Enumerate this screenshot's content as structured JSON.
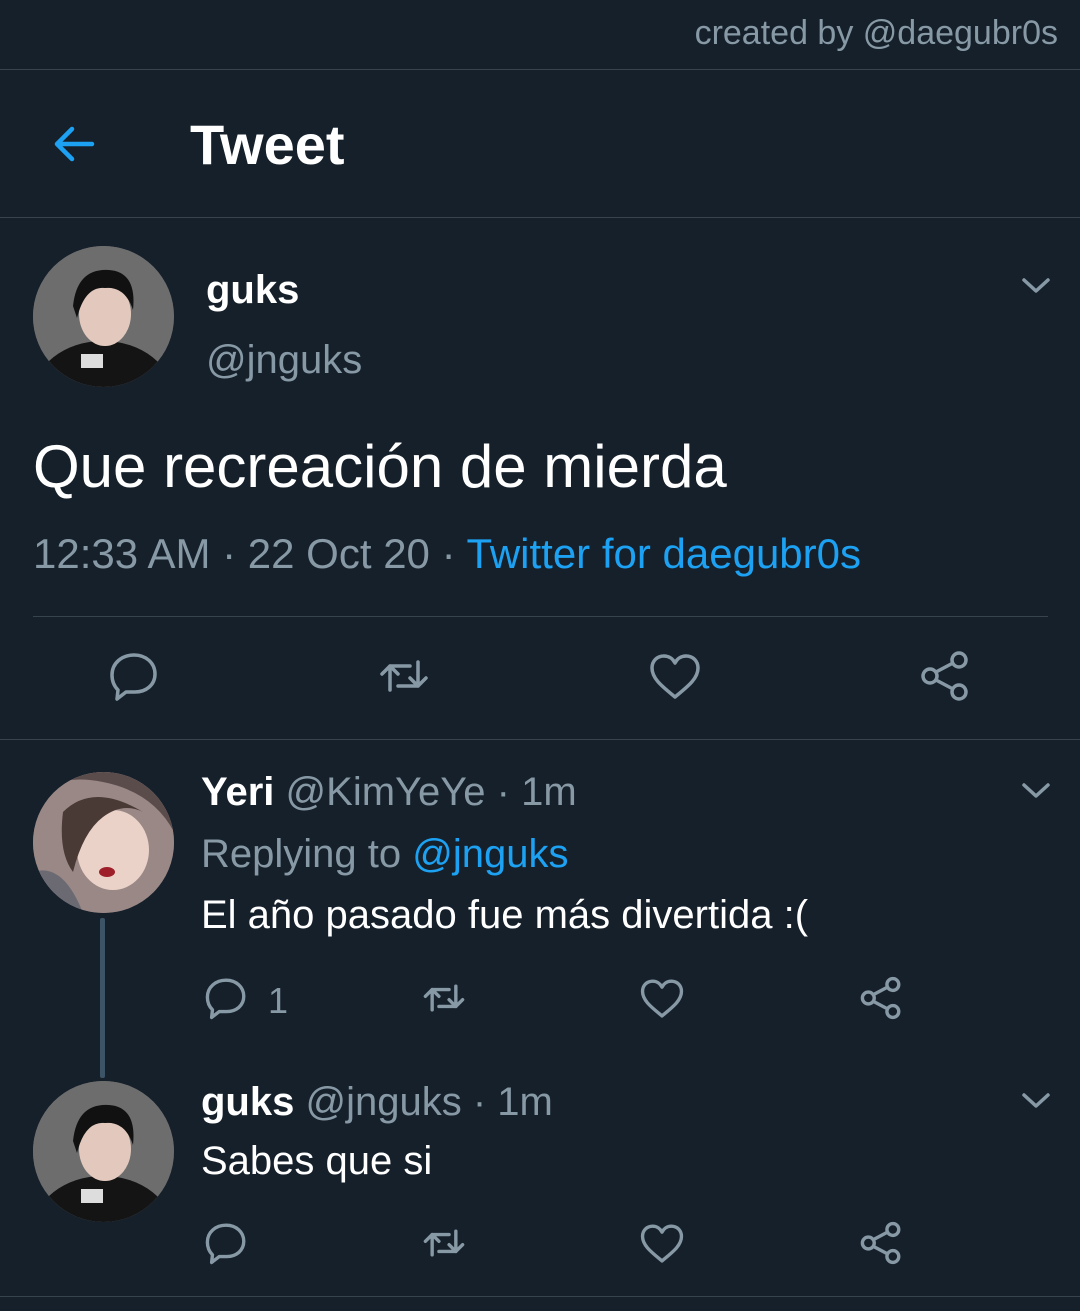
{
  "credit": "created by @daegubr0s",
  "header": {
    "title": "Tweet",
    "back_icon": "arrow-left-icon",
    "accent": "#1da1f2"
  },
  "main_tweet": {
    "name": "guks",
    "handle": "@jnguks",
    "text": "Que recreación de mierda",
    "time": "12:33 AM",
    "sep1": " · ",
    "date": "22 Oct 20",
    "sep2": " · ",
    "source": "Twitter for daegubr0s",
    "actions": [
      "reply-icon",
      "retweet-icon",
      "like-icon",
      "share-icon"
    ]
  },
  "replies": [
    {
      "name": "Yeri",
      "handle": "@KimYeYe",
      "dot": " · ",
      "time": "1m",
      "replying_label": "Replying to ",
      "replying_to": "@jnguks",
      "text": "El año pasado fue más divertida :(",
      "reply_count": "1"
    },
    {
      "name": "guks",
      "handle": "@jnguks",
      "dot": " · ",
      "time": "1m",
      "text": "Sabes que si"
    }
  ],
  "colors": {
    "background": "#15202b",
    "divider": "#38444d",
    "muted": "#8899a6",
    "link": "#1da1f2"
  }
}
